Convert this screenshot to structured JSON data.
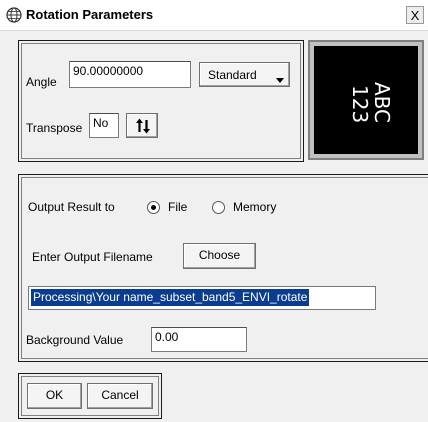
{
  "window": {
    "title": "Rotation Parameters",
    "close_label": "X"
  },
  "rotation": {
    "angle_label": "Angle",
    "angle_value": "90.00000000",
    "standard_label": "Standard",
    "transpose_label": "Transpose",
    "transpose_value": "No"
  },
  "preview": {
    "line1": "ABC",
    "line2": "123"
  },
  "output": {
    "label": "Output Result to",
    "option_file": "File",
    "option_memory": "Memory",
    "selected": "File",
    "filename_label": "Enter Output Filename",
    "choose_label": "Choose",
    "filename_value": "Processing\\Your name_subset_band5_ENVI_rotate",
    "background_label": "Background Value",
    "background_value": "0.00"
  },
  "buttons": {
    "ok": "OK",
    "cancel": "Cancel"
  },
  "icons": {
    "title_icon": "globe-icon",
    "dropdown_icon": "triangle-down-icon",
    "swap_icon": "up-down-arrows-icon"
  }
}
